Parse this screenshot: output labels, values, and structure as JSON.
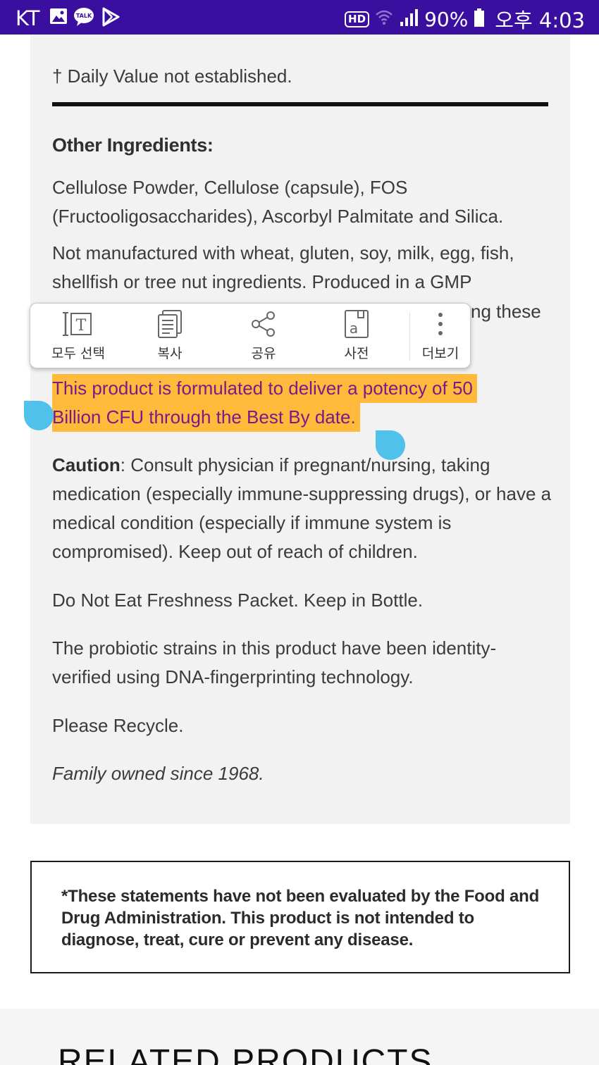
{
  "status_bar": {
    "carrier": "KT",
    "icons": [
      "gallery-icon",
      "kakaotalk-icon",
      "play-store-icon"
    ],
    "hd_badge": "HD",
    "battery": "90%",
    "time": "오후 4:03",
    "bg_color": "#3a0fa0"
  },
  "content": {
    "daily_value_note": "† Daily Value not established.",
    "other_ingredients_heading": "Other Ingredients:",
    "ingredients_text": "Cellulose Powder, Cellulose (capsule), FOS (Fructooligosaccharides), Ascorbyl Palmitate and Silica.",
    "allergen_text": "Not manufactured with wheat, gluten, soy, milk, egg, fish, shellfish or tree nut ingredients. Produced in a GMP",
    "allergen_partial": "ng these",
    "selected_line_1": "This product is formulated to deliver a potency of 50",
    "selected_line_2": "Billion CFU through the Best By date.",
    "caution_label": "Caution",
    "caution_text": ": Consult physician if pregnant/nursing, taking medication (especially immune-suppressing drugs), or have a medical condition (especially if immune system is compromised). Keep out of reach of children.",
    "freshness_text": "Do Not Eat Freshness Packet. Keep in Bottle.",
    "strains_text": "The probiotic strains in this product have been identity-verified using DNA-fingerprinting technology.",
    "recycle_text": "Please Recycle.",
    "family_text": "Family owned since 1968."
  },
  "selection_toolbar": {
    "items": [
      {
        "label": "모두 선택",
        "icon": "select-all-icon"
      },
      {
        "label": "복사",
        "icon": "copy-icon"
      },
      {
        "label": "공유",
        "icon": "share-icon"
      },
      {
        "label": "사전",
        "icon": "dictionary-icon"
      },
      {
        "label": "더보기",
        "icon": "more-vert-icon"
      }
    ]
  },
  "disclaimer": {
    "text": "*These statements have not been evaluated by the Food and Drug Administration. This product is not intended to diagnose, treat, cure or prevent any disease."
  },
  "related": {
    "heading": "RELATED PRODUCTS"
  },
  "colors": {
    "highlight": "#ffba3b",
    "selection_handle": "#4fc1ea",
    "card_bg": "#f2f2f3"
  }
}
